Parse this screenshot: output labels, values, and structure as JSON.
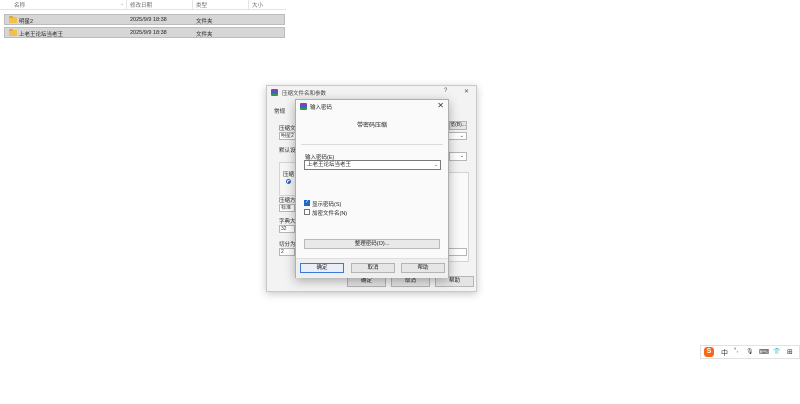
{
  "explorer": {
    "columns": [
      "名称",
      "修改日期",
      "类型",
      "大小"
    ],
    "rows": [
      {
        "name": "明星2",
        "date": "2025/9/9 18:38",
        "type": "文件夹"
      },
      {
        "name": "上老王论坛当老王",
        "date": "2025/9/9 18:38",
        "type": "文件夹"
      }
    ]
  },
  "archive_dialog": {
    "title": "压缩文件名和参数",
    "help_glyph": "?",
    "close_glyph": "✕",
    "tab": "常规",
    "label_archive_name": "压缩文",
    "archive_name_value": "明星2",
    "label_default": "默认设",
    "label_format": "压缩",
    "label_method": "压缩方",
    "method_value": "标准",
    "label_dict": "字典大",
    "dict_value": "32",
    "label_split": "切分为",
    "split_value": "2",
    "browse_label": "览(B)...",
    "ok": "确定",
    "cancel": "取消",
    "help": "帮助"
  },
  "password_dialog": {
    "title": "输入密码",
    "close_glyph": "✕",
    "heading": "带密码压缩",
    "input_label": "输入密码(E)",
    "password_value": "上老王论坛当老王",
    "show_password_label": "显示密码(S)",
    "show_password_checked": true,
    "encrypt_names_label": "加密文件名(N)",
    "encrypt_names_checked": false,
    "organize_label": "整理密码(O)...",
    "ok": "确定",
    "cancel": "取消",
    "help": "帮助"
  },
  "ime_toolbar": {
    "logo": "S",
    "mode": "中",
    "punct": "°,",
    "mic": "🎙",
    "keyboard": "⌨",
    "skin": "👕",
    "grid": "⊞"
  }
}
